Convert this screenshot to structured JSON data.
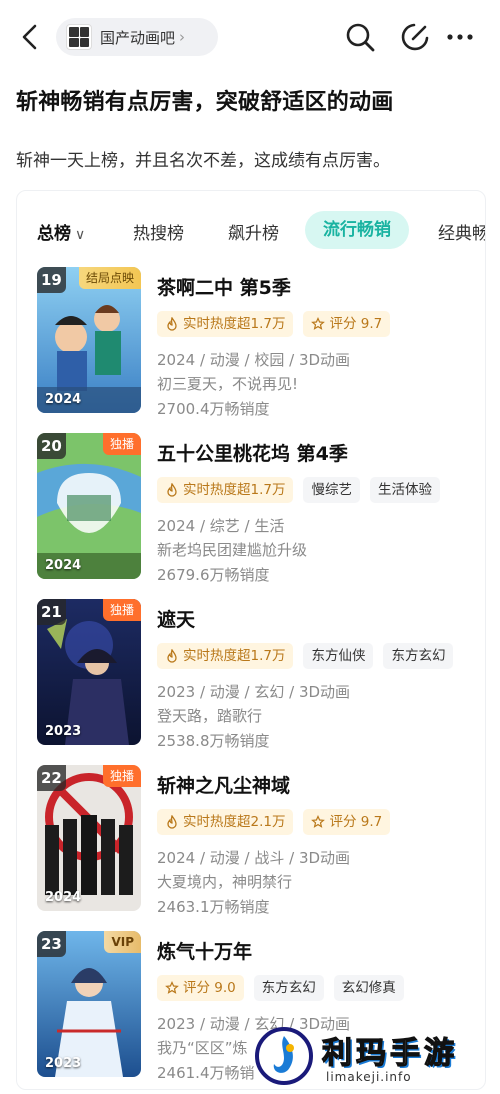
{
  "header": {
    "forum_name": "国产动画吧",
    "chevron": "›"
  },
  "post": {
    "title": "斩神畅销有点厉害，突破舒适区的动画",
    "body": "斩神一天上榜，并且名次不差，这成绩有点厉害。"
  },
  "tabs": [
    {
      "label": "总榜",
      "active": false
    },
    {
      "label": "热搜榜",
      "active": false
    },
    {
      "label": "飙升榜",
      "active": false
    },
    {
      "label": "流行畅销",
      "active": true
    },
    {
      "label": "经典畅销",
      "active": false
    }
  ],
  "tab_total_chevron": "∨",
  "items": [
    {
      "rank": "19",
      "badge": "结局点映",
      "badge_style": "gold",
      "poster_year": "2024",
      "name": "茶啊二中 第5季",
      "chips": [
        "实时热度超1.7万",
        "评分 9.7"
      ],
      "meta1": "2024 / 动漫 / 校园 / 3D动画",
      "meta2": "初三夏天，不说再见!",
      "sales": "2700.4万畅销度"
    },
    {
      "rank": "20",
      "badge": "独播",
      "badge_style": "orange",
      "poster_year": "2024",
      "name": "五十公里桃花坞 第4季",
      "chips": [
        "实时热度超1.7万",
        "慢综艺",
        "生活体验"
      ],
      "meta1": "2024 / 综艺 / 生活",
      "meta2": "新老坞民团建尴尬升级",
      "sales": "2679.6万畅销度"
    },
    {
      "rank": "21",
      "badge": "独播",
      "badge_style": "orange",
      "poster_year": "2023",
      "name": "遮天",
      "chips": [
        "实时热度超1.7万",
        "东方仙侠",
        "东方玄幻"
      ],
      "meta1": "2023 / 动漫 / 玄幻 / 3D动画",
      "meta2": "登天路，踏歌行",
      "sales": "2538.8万畅销度"
    },
    {
      "rank": "22",
      "badge": "独播",
      "badge_style": "orange",
      "poster_year": "2024",
      "name": "斩神之凡尘神域",
      "chips": [
        "实时热度超2.1万",
        "评分 9.7"
      ],
      "meta1": "2024 / 动漫 / 战斗 / 3D动画",
      "meta2": "大夏境内，神明禁行",
      "sales": "2463.1万畅销度"
    },
    {
      "rank": "23",
      "badge": "VIP",
      "badge_style": "vip",
      "poster_year": "2023",
      "name": "炼气十万年",
      "chips": [
        "评分 9.0",
        "东方玄幻",
        "玄幻修真"
      ],
      "meta1": "2023 / 动漫 / 玄幻 / 3D动画",
      "meta2": "我乃“区区”炼",
      "sales": "2461.4万畅销"
    }
  ],
  "watermark": {
    "brand": "利玛手游",
    "url": "limakeji.info"
  },
  "colors": {
    "accent": "#19b3a1",
    "hot_chip_bg": "#fff5e0",
    "hot_chip_text": "#b9781a",
    "exclusive_badge": "#ff6f2c"
  }
}
